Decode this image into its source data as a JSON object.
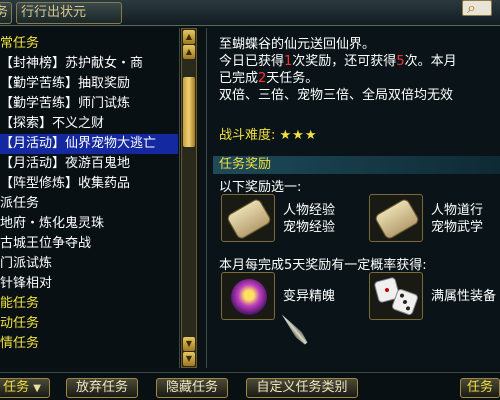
{
  "top": {
    "left_tab": "务",
    "main_tab": "行行出状元"
  },
  "quest_list": [
    {
      "label": "常任务",
      "color": "yellow"
    },
    {
      "label": "【封神榜】苏护献女・商",
      "color": "white"
    },
    {
      "label": "【勤学苦练】抽取奖励",
      "color": "white"
    },
    {
      "label": "【勤学苦练】师门试炼",
      "color": "white"
    },
    {
      "label": "【探索】不义之财",
      "color": "white"
    },
    {
      "label": "【月活动】仙界宠物大逃亡",
      "color": "selected"
    },
    {
      "label": "【月活动】夜游百鬼地",
      "color": "white"
    },
    {
      "label": "【阵型修炼】收集药品",
      "color": "white"
    },
    {
      "label": "派任务",
      "color": "white"
    },
    {
      "label": "地府・炼化鬼灵珠",
      "color": "white"
    },
    {
      "label": "古城王位争夺战",
      "color": "white"
    },
    {
      "label": "门派试炼",
      "color": "white"
    },
    {
      "label": "针锋相对",
      "color": "white"
    },
    {
      "label": "能任务",
      "color": "yellow"
    },
    {
      "label": "动任务",
      "color": "yellow"
    },
    {
      "label": "情任务",
      "color": "yellow"
    }
  ],
  "detail": {
    "line1": "至蝴蝶谷的仙元送回仙界。",
    "line2_a": "今日已获得",
    "line2_n": "1",
    "line2_b": "次奖励，还可获得",
    "line2_m": "5",
    "line2_c": "次。本月",
    "line3_a": "已完成",
    "line3_n": "2",
    "line3_b": "天任务。",
    "line4": "双倍、三倍、宠物三倍、全局双倍均无效",
    "difficulty_label": "战斗难度:",
    "stars": "★★★"
  },
  "rewards": {
    "header": "任务奖励",
    "choose": "以下奖励选一:",
    "item1_l1": "人物经验",
    "item1_l2": "宠物经验",
    "item2_l1": "人物道行",
    "item2_l2": "宠物武学",
    "monthly": "本月每完成5天奖励有一定概率获得:",
    "item3": "变异精魄",
    "item4": "满属性装备"
  },
  "bottom": {
    "tasks_btn": "任务",
    "abandon": "放弃任务",
    "hide": "隐藏任务",
    "custom": "自定义任务类别",
    "right_btn": "任务"
  }
}
